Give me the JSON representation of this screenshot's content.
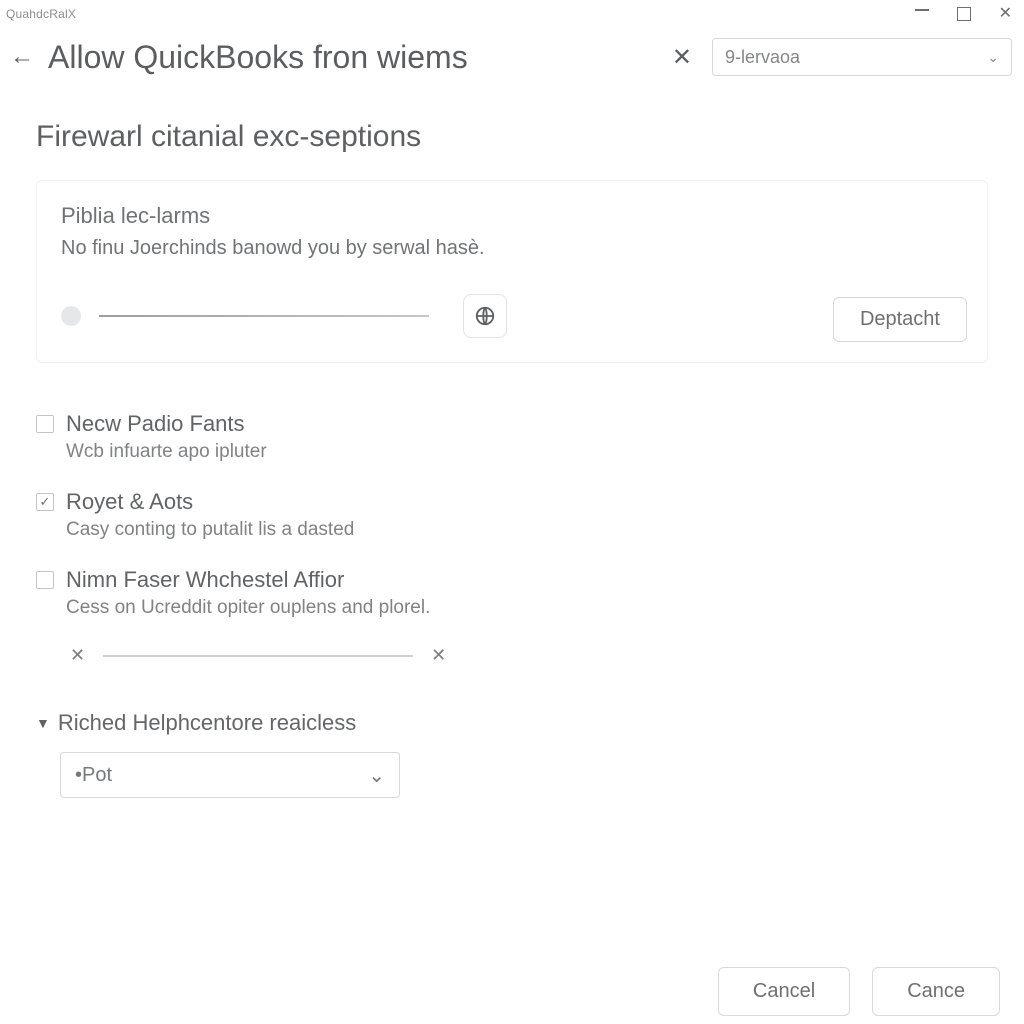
{
  "window": {
    "brand": "QuahdcRalX"
  },
  "header": {
    "title": "Allow QuickBooks fron wiems",
    "select_value": "9-lervaoa"
  },
  "section": {
    "title": "Firewarl citanial exc-septions"
  },
  "card": {
    "title": "Piblia lec-larms",
    "subtitle": "No finu Joerchinds banowd you by serwal hasè.",
    "action_label": "Deptacht"
  },
  "options": [
    {
      "checked": false,
      "title": "Necw Padio Fants",
      "desc": "Wcb infuarte apo ipluter"
    },
    {
      "checked": true,
      "title": "Royet & Aots",
      "desc": "Casy conting to putalit lis a dasted"
    },
    {
      "checked": false,
      "title": "Nimn Faser Whchestel Affior",
      "desc": "Cess on Ucreddit opiter ouplens and plorel."
    }
  ],
  "collapsible": {
    "label": "Riched Helphcentore reaicless",
    "select_value": "•Pot"
  },
  "footer": {
    "cancel": "Cancel",
    "cance": "Cance"
  }
}
